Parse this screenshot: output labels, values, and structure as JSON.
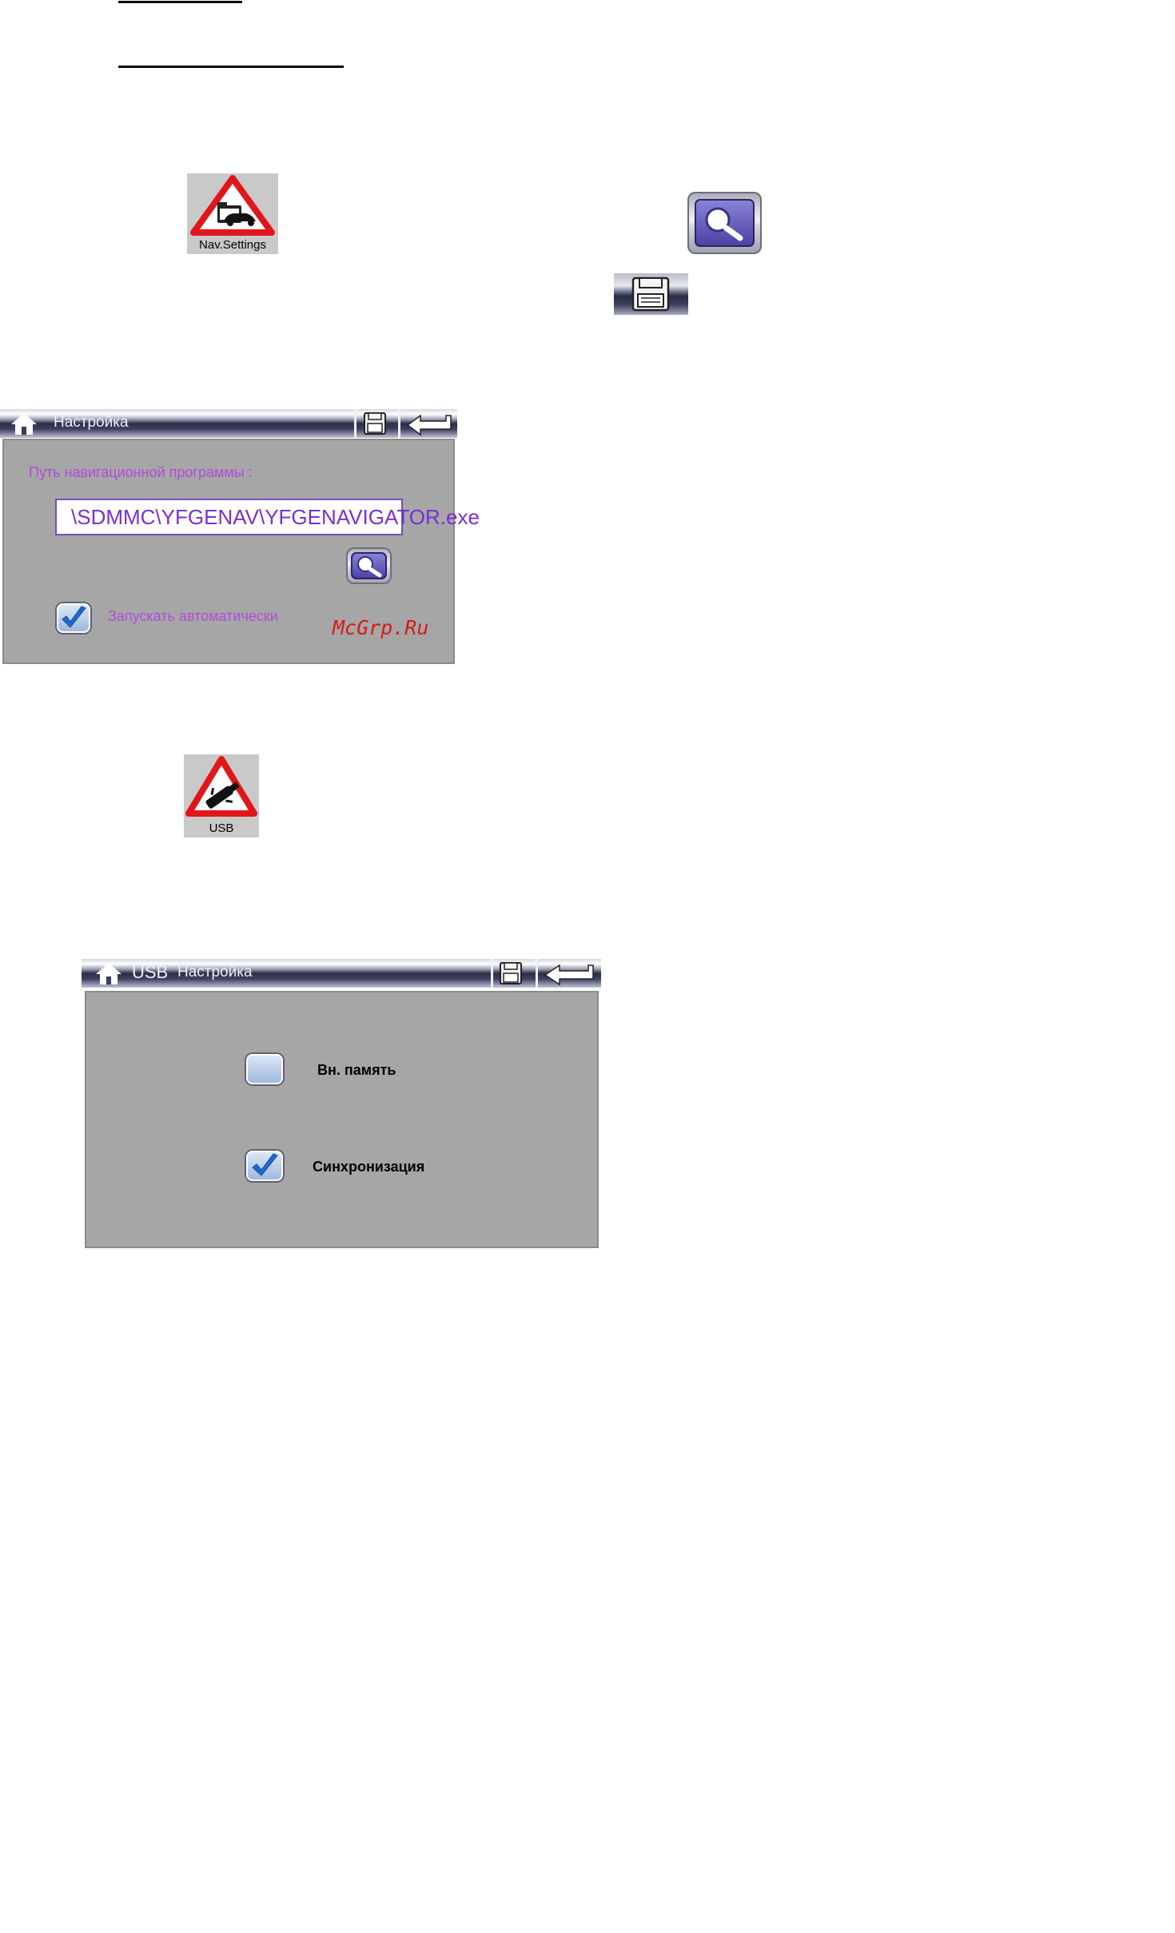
{
  "nav_tile": {
    "label": "Nav.Settings",
    "icon": "car-folder-warning-icon"
  },
  "usb_tile": {
    "label": "USB",
    "icon": "usb-warning-icon"
  },
  "nav_screen": {
    "title": "Настройка",
    "path_label": "Путь навигационной программы :",
    "path_value": "\\SDMMC\\YFGENAV\\YFGENAVIGATOR.exe",
    "autostart_label": "Запускать автоматически",
    "autostart_checked": true,
    "watermark": "McGrp.Ru"
  },
  "usb_screen": {
    "title_prefix": "USB",
    "title": "Настройка",
    "options": [
      {
        "label": "Вн. память",
        "checked": false
      },
      {
        "label": "Синхронизация",
        "checked": true
      }
    ]
  },
  "colors": {
    "accent_purple": "#b14adc",
    "panel_gray": "#a6a6a6",
    "warning_red": "#e0161b"
  }
}
